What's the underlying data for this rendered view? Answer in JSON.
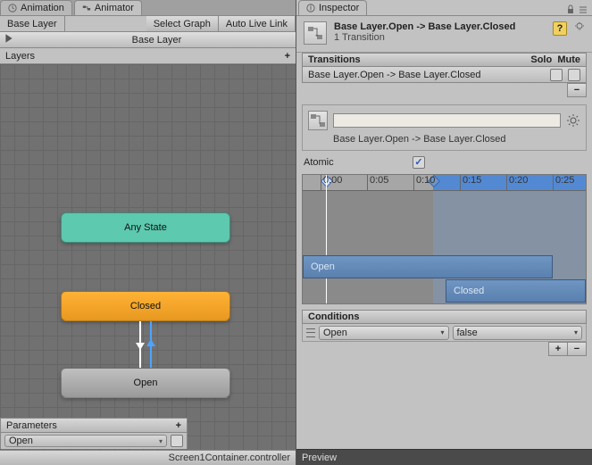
{
  "tabs": {
    "animation": "Animation",
    "animator": "Animator",
    "inspector": "Inspector"
  },
  "breadcrumb": {
    "base": "Base Layer",
    "selectgraph": "Select Graph",
    "autolive": "Auto Live Link"
  },
  "layerbar": {
    "title": "Base Layer"
  },
  "layers_label": "Layers",
  "graph": {
    "any_state": "Any State",
    "closed": "Closed",
    "open": "Open"
  },
  "parameters": {
    "header": "Parameters",
    "items": [
      {
        "name": "Open",
        "checked": false
      }
    ]
  },
  "statusbar": "Screen1Container.controller",
  "inspector": {
    "title": "Base Layer.Open -> Base Layer.Closed",
    "subtitle": "1 Transition",
    "transitions": {
      "header": "Transitions",
      "solo": "Solo",
      "mute": "Mute",
      "rows": [
        {
          "label": "Base Layer.Open -> Base Layer.Closed",
          "solo": false,
          "mute": false
        }
      ]
    },
    "namebox": {
      "value": "",
      "caption": "Base Layer.Open -> Base Layer.Closed"
    },
    "atomic": {
      "label": "Atomic",
      "checked": true
    },
    "timeline": {
      "ticks": [
        "0:00",
        "0:05",
        "0:10",
        "0:15",
        "0:20",
        "0:25"
      ],
      "playhead": "0:00",
      "selection_start": "0:13",
      "selection_end": "0:30",
      "clips": [
        {
          "name": "Open"
        },
        {
          "name": "Closed"
        }
      ]
    },
    "conditions": {
      "header": "Conditions",
      "rows": [
        {
          "param": "Open",
          "value": "false"
        }
      ]
    },
    "preview": "Preview"
  }
}
